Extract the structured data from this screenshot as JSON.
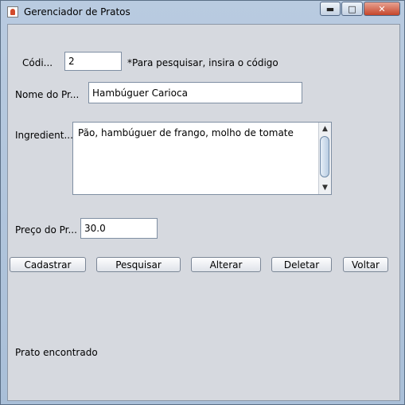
{
  "window": {
    "title": "Gerenciador de Pratos",
    "minimize_icon": "minimize-icon",
    "maximize_icon": "maximize-icon",
    "close_icon": "close-icon"
  },
  "form": {
    "codigo_label": "Códi...",
    "codigo_value": "2",
    "codigo_hint": "*Para pesquisar, insira o código",
    "nome_label": "Nome do Pr...",
    "nome_value": "Hambúguer Carioca",
    "ingredientes_label": "Ingredient...",
    "ingredientes_value": "Pão,  hambúguer de frango, molho de tomate",
    "preco_label": "Preço do Pr...",
    "preco_value": "30.0"
  },
  "buttons": {
    "cadastrar": "Cadastrar",
    "pesquisar": "Pesquisar",
    "alterar": "Alterar",
    "deletar": "Deletar",
    "voltar": "Voltar"
  },
  "status": {
    "message": "Prato encontrado"
  }
}
